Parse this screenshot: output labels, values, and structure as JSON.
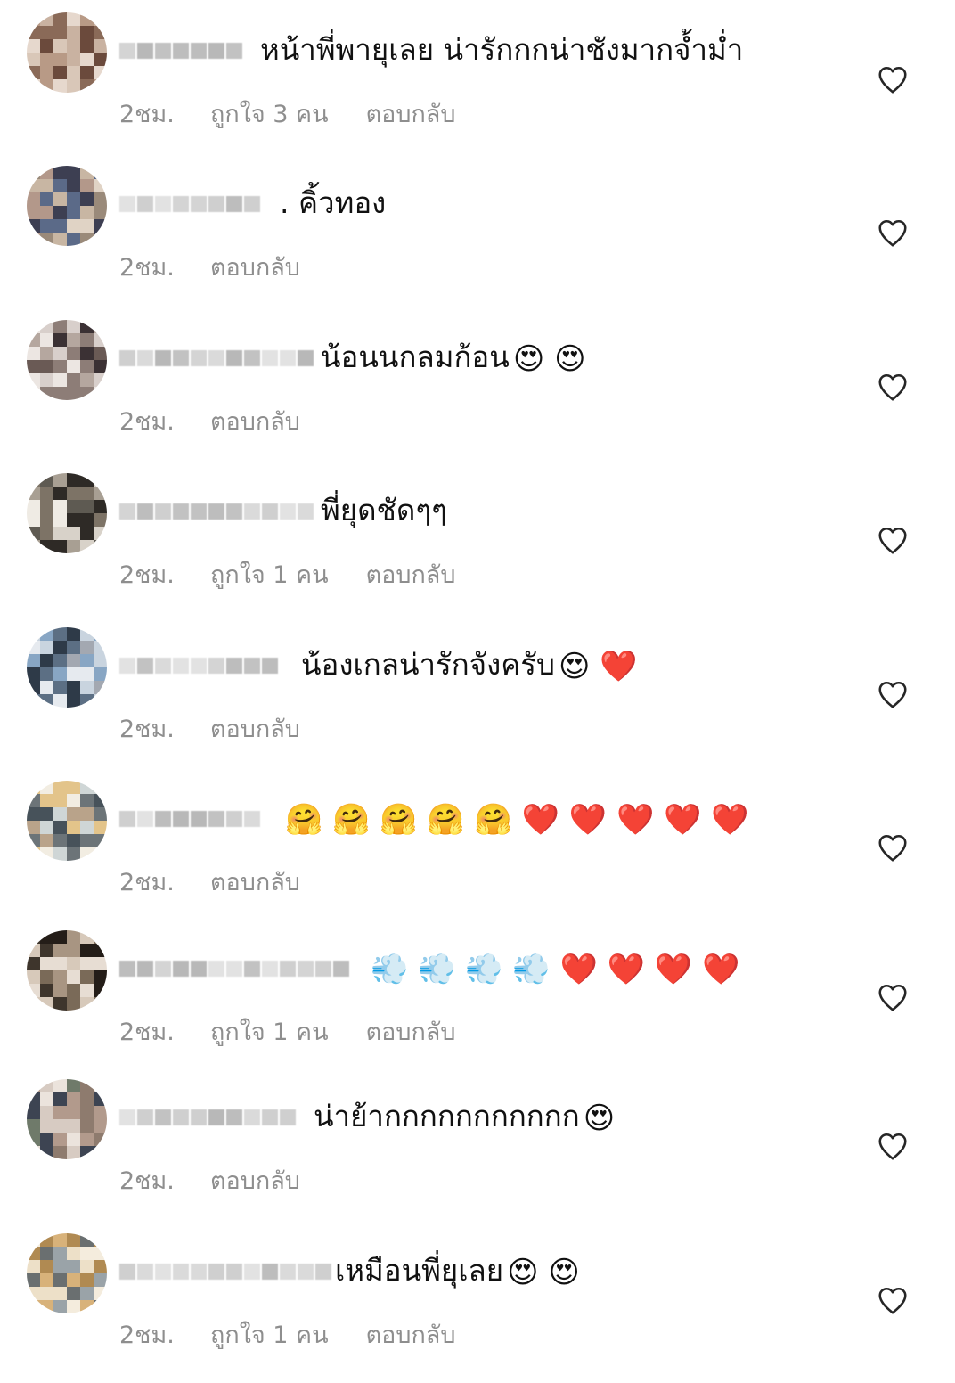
{
  "comments": [
    {
      "text": "หน้าพี่พายุเลย น่ารักกกน่าชังมากจ้ำม่ำ",
      "emoji": "",
      "time": "2ชม.",
      "likes": "ถูกใจ 3 คน",
      "reply": "ตอบกลับ"
    },
    {
      "text": ". คิ้วทอง",
      "emoji": "",
      "time": "2ชม.",
      "likes": "",
      "reply": "ตอบกลับ"
    },
    {
      "text": "น้อนนกลมก้อน",
      "emoji": "😍 😍",
      "time": "2ชม.",
      "likes": "",
      "reply": "ตอบกลับ"
    },
    {
      "text": "พี่ยุดชัดๆๆ",
      "emoji": "",
      "time": "2ชม.",
      "likes": "ถูกใจ 1 คน",
      "reply": "ตอบกลับ"
    },
    {
      "text": "น้องเกลน่ารักจังครับ",
      "emoji": "😍 ❤️",
      "time": "2ชม.",
      "likes": "",
      "reply": "ตอบกลับ"
    },
    {
      "text": "",
      "emoji": "🤗 🤗 🤗 🤗 🤗 ❤️ ❤️ ❤️ ❤️ ❤️",
      "time": "2ชม.",
      "likes": "",
      "reply": "ตอบกลับ"
    },
    {
      "text": "",
      "emoji": "💨 💨 💨 💨 ❤️ ❤️ ❤️ ❤️",
      "time": "2ชม.",
      "likes": "ถูกใจ 1 คน",
      "reply": "ตอบกลับ"
    },
    {
      "text": "น่าย้ากกกกกกกกกกก",
      "emoji": "😍",
      "time": "2ชม.",
      "likes": "",
      "reply": "ตอบกลับ"
    },
    {
      "text": "เหมือนพี่ยุเลย",
      "emoji": "😍 😍",
      "time": "2ชม.",
      "likes": "ถูกใจ 1 คน",
      "reply": "ตอบกลับ"
    }
  ],
  "colors": {
    "text": "#111111",
    "meta": "#8e8e8e",
    "heart_outline": "#262626"
  },
  "icons": {
    "like": "heart-outline-icon"
  }
}
